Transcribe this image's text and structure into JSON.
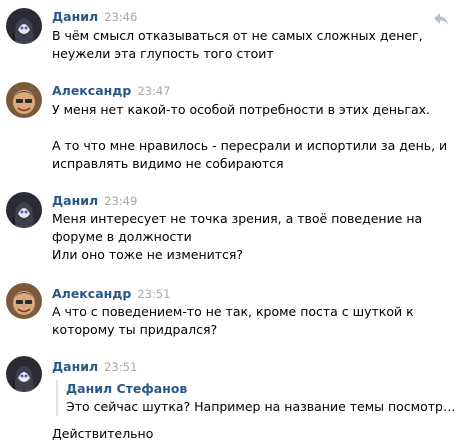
{
  "messages": [
    {
      "author": "Данил",
      "time": "23:46",
      "lines": [
        "В чём смысл отказываться от не самых сложных денег,",
        "неужели эта глупость того стоит"
      ]
    },
    {
      "author": "Александр",
      "time": "23:47",
      "paragraphs": [
        "У меня нет какой-то особой потребности в этих деньгах.",
        "А то что мне нравилось - пересрали и испортили за день, и",
        "исправлять видимо не собираются"
      ]
    },
    {
      "author": "Данил",
      "time": "23:49",
      "lines": [
        "Меня интересует не точка зрения, а твоё поведение на",
        "форуме в должности",
        "Или оно тоже не изменится?"
      ]
    },
    {
      "author": "Александр",
      "time": "23:51",
      "lines": [
        "А что с поведением-то не так, кроме поста с шуткой к",
        "которому ты придрался?"
      ]
    },
    {
      "author": "Данил",
      "time": "23:51",
      "quote": {
        "author": "Данил Стефанов",
        "text": "Это сейчас шутка? Например на название темы посмотри, ..."
      },
      "after_quote": "Действительно"
    }
  ],
  "icons": {
    "reply": "reply-icon",
    "avatar_danil": "dark-masked-figure",
    "avatar_alexandr": "smiling-face"
  },
  "colors": {
    "author": "#2a5885",
    "time": "#a8a8a8",
    "quote_border": "#dfe3e8"
  }
}
